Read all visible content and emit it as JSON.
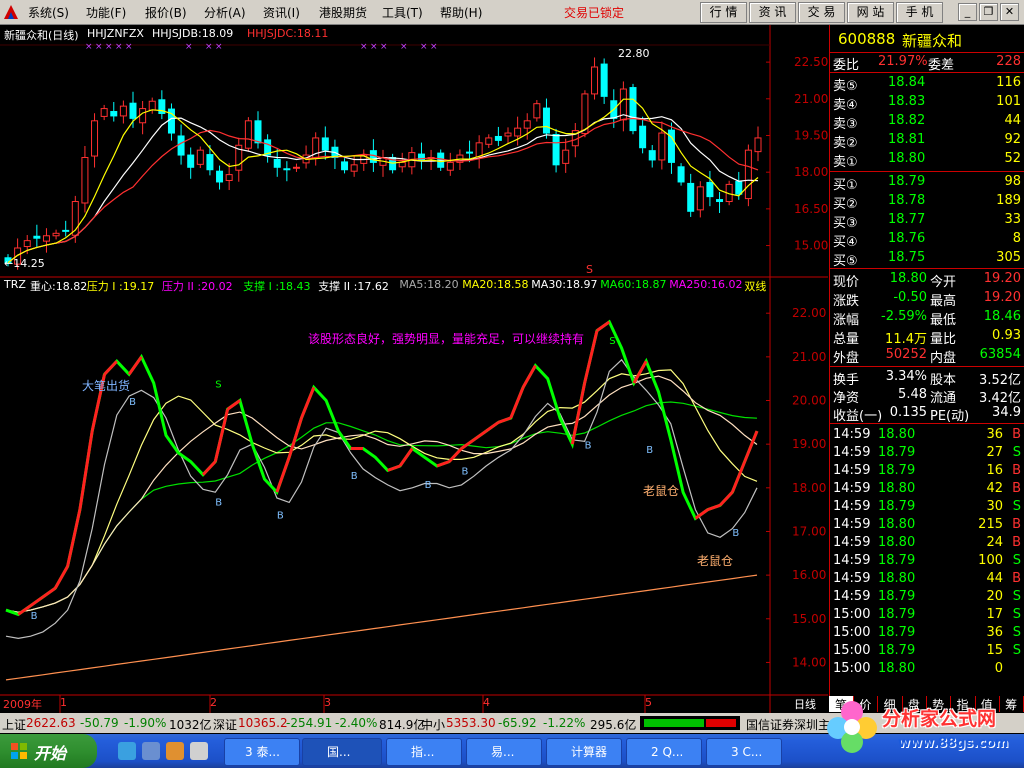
{
  "menu": {
    "items": [
      "系统(S)",
      "功能(F)",
      "报价(B)",
      "分析(A)",
      "资讯(I)",
      "港股期货",
      "工具(T)",
      "帮助(H)"
    ],
    "lock_status": "交易已锁定",
    "quick_buttons": [
      "行 情",
      "资 讯",
      "交 易",
      "网 站",
      "手 机"
    ]
  },
  "kline_header": {
    "title": "新疆众和(日线)",
    "indicator": "HHJZNFZX",
    "jdb_label": "HHJSJDB:18.09",
    "jdc_label": "HHJSJDC:18.11",
    "high_marker": "22.80",
    "low_marker": "←14.25",
    "s_marker": "S"
  },
  "trz_header": {
    "name": "TRZ",
    "items": [
      {
        "text": "重心:18.82",
        "color": "#ffffff"
      },
      {
        "text": "压力 I :19.17",
        "color": "#ffff00"
      },
      {
        "text": "压力 II :20.02",
        "color": "#ff00ff"
      },
      {
        "text": "支撑 I :18.43",
        "color": "#00ff00"
      },
      {
        "text": "支撑 II :17.62",
        "color": "#ffffff"
      },
      {
        "text": "MA5:18.20",
        "color": "#aaaaaa"
      },
      {
        "text": "MA20:18.58",
        "color": "#ffff00"
      },
      {
        "text": "MA30:18.97",
        "color": "#ffffff"
      },
      {
        "text": "MA60:18.87",
        "color": "#00ff00"
      },
      {
        "text": "MA250:16.02",
        "color": "#ff00ff"
      },
      {
        "text": "双线",
        "color": "#ffff00"
      }
    ],
    "comment": "该股形态良好，强势明显，量能充足，可以继续持有",
    "annotations": {
      "top_exit": "大笔出货",
      "laoshu1": "老鼠仓",
      "laoshu2": "老鼠仓"
    }
  },
  "time_axis": {
    "year_label": "2009年",
    "months": [
      "1",
      "2",
      "3",
      "4",
      "5"
    ],
    "period": "日线"
  },
  "chart_data": [
    {
      "type": "candlestick",
      "title": "新疆众和(日线)",
      "y_ticks": [
        22.5,
        21.0,
        19.5,
        18.0,
        16.5,
        15.0
      ],
      "ylim": [
        14.0,
        23.2
      ],
      "closes": [
        14.3,
        14.9,
        15.2,
        15.3,
        15.4,
        15.5,
        15.6,
        16.8,
        18.6,
        20.1,
        20.6,
        20.3,
        20.7,
        20.2,
        20.6,
        20.9,
        20.4,
        19.6,
        18.7,
        18.2,
        18.9,
        18.1,
        17.6,
        17.9,
        19.1,
        20.1,
        19.2,
        18.7,
        18.2,
        18.1,
        18.2,
        18.7,
        19.4,
        18.9,
        18.6,
        18.1,
        18.3,
        18.7,
        18.4,
        18.6,
        18.1,
        18.4,
        18.8,
        18.5,
        18.6,
        18.2,
        18.4,
        18.7,
        18.8,
        19.2,
        19.4,
        19.3,
        19.6,
        19.8,
        20.1,
        20.8,
        19.6,
        18.3,
        18.9,
        19.7,
        21.2,
        22.3,
        21.1,
        20.2,
        21.4,
        19.7,
        19.0,
        18.5,
        19.6,
        18.4,
        17.6,
        16.4,
        17.4,
        17.0,
        16.8,
        17.5,
        17.1,
        18.9,
        19.4
      ]
    },
    {
      "type": "line",
      "title": "TRZ",
      "y_ticks": [
        22.0,
        21.0,
        20.0,
        19.0,
        18.0,
        17.0,
        16.0,
        15.0,
        14.0
      ],
      "ylim": [
        13.3,
        22.6
      ],
      "series": [
        {
          "name": "重心",
          "values": [
            15.2,
            15.1,
            15.3,
            15.5,
            15.7,
            16.2,
            17.5,
            19.3,
            20.6,
            20.9,
            20.6,
            21.0,
            20.4,
            19.2,
            18.8,
            18.6,
            18.3,
            18.6,
            19.8,
            20.0,
            19.0,
            18.2,
            17.9,
            18.7,
            19.6,
            20.3,
            20.0,
            19.3,
            18.9,
            18.9,
            18.7,
            18.4,
            18.5,
            18.9,
            18.7,
            18.5,
            18.6,
            18.9,
            19.1,
            19.3,
            19.5,
            19.6,
            20.3,
            20.8,
            20.5,
            19.6,
            19.0,
            20.4,
            21.6,
            21.8,
            21.2,
            20.4,
            20.9,
            20.2,
            19.1,
            17.9,
            17.3,
            17.5,
            17.6,
            17.9,
            18.6,
            19.3
          ]
        }
      ]
    }
  ],
  "quote": {
    "code": "600888",
    "name": "新疆众和",
    "ratio_label": "委比",
    "ratio": "21.97%",
    "diff_label": "委差",
    "diff": "228",
    "asks": [
      {
        "label": "卖⑤",
        "price": "18.84",
        "vol": "116"
      },
      {
        "label": "卖④",
        "price": "18.83",
        "vol": "101"
      },
      {
        "label": "卖③",
        "price": "18.82",
        "vol": "44"
      },
      {
        "label": "卖②",
        "price": "18.81",
        "vol": "92"
      },
      {
        "label": "卖①",
        "price": "18.80",
        "vol": "52"
      }
    ],
    "bids": [
      {
        "label": "买①",
        "price": "18.79",
        "vol": "98"
      },
      {
        "label": "买②",
        "price": "18.78",
        "vol": "189"
      },
      {
        "label": "买③",
        "price": "18.77",
        "vol": "33"
      },
      {
        "label": "买④",
        "price": "18.76",
        "vol": "8"
      },
      {
        "label": "买⑤",
        "price": "18.75",
        "vol": "305"
      }
    ],
    "stats1": [
      {
        "l1": "现价",
        "v1": "18.80",
        "c1": "#00ff00",
        "l2": "今开",
        "v2": "19.20",
        "c2": "#ff3030"
      },
      {
        "l1": "涨跌",
        "v1": "-0.50",
        "c1": "#00ff00",
        "l2": "最高",
        "v2": "19.20",
        "c2": "#ff3030"
      },
      {
        "l1": "涨幅",
        "v1": "-2.59%",
        "c1": "#00ff00",
        "l2": "最低",
        "v2": "18.46",
        "c2": "#00ff00"
      },
      {
        "l1": "总量",
        "v1": "11.4万",
        "c1": "#ffff00",
        "l2": "量比",
        "v2": "0.93",
        "c2": "#ffff00"
      },
      {
        "l1": "外盘",
        "v1": "50252",
        "c1": "#ff3030",
        "l2": "内盘",
        "v2": "63854",
        "c2": "#00ff00"
      }
    ],
    "stats2": [
      {
        "l1": "换手",
        "v1": "3.34%",
        "l2": "股本",
        "v2": "3.52亿"
      },
      {
        "l1": "净资",
        "v1": "5.48",
        "l2": "流通",
        "v2": "3.42亿"
      },
      {
        "l1": "收益(一)",
        "v1": "0.135",
        "l2": "PE(动)",
        "v2": "34.9"
      }
    ],
    "ticks": [
      {
        "t": "14:59",
        "p": "18.80",
        "v": "36",
        "d": "B"
      },
      {
        "t": "14:59",
        "p": "18.79",
        "v": "27",
        "d": "S"
      },
      {
        "t": "14:59",
        "p": "18.79",
        "v": "16",
        "d": "B"
      },
      {
        "t": "14:59",
        "p": "18.80",
        "v": "42",
        "d": "B"
      },
      {
        "t": "14:59",
        "p": "18.79",
        "v": "30",
        "d": "S"
      },
      {
        "t": "14:59",
        "p": "18.80",
        "v": "215",
        "d": "B"
      },
      {
        "t": "14:59",
        "p": "18.80",
        "v": "24",
        "d": "B"
      },
      {
        "t": "14:59",
        "p": "18.79",
        "v": "100",
        "d": "S"
      },
      {
        "t": "14:59",
        "p": "18.80",
        "v": "44",
        "d": "B"
      },
      {
        "t": "14:59",
        "p": "18.79",
        "v": "20",
        "d": "S"
      },
      {
        "t": "15:00",
        "p": "18.79",
        "v": "17",
        "d": "S"
      },
      {
        "t": "15:00",
        "p": "18.79",
        "v": "36",
        "d": "S"
      },
      {
        "t": "15:00",
        "p": "18.79",
        "v": "15",
        "d": "S"
      },
      {
        "t": "15:00",
        "p": "18.80",
        "v": "0",
        "d": ""
      }
    ],
    "tabs": [
      "笔",
      "价",
      "细",
      "盘",
      "势",
      "指",
      "值",
      "筹"
    ]
  },
  "index_bar": {
    "sh_label": "上证",
    "sh_val": "2622.63",
    "sh_chg": "-50.79",
    "sh_pct": "-1.90%",
    "sh_amt": "1032亿",
    "sz_label": "深证",
    "sz_val": "10365.2",
    "sz_chg": "-254.91",
    "sz_pct": "-2.40%",
    "sz_amt": "814.9亿",
    "zx_label": "中小",
    "zx_val": "5353.30",
    "zx_chg": "-65.92",
    "zx_pct": "-1.22%",
    "zx_amt": "295.6亿",
    "broker": "国信证券深圳主"
  },
  "taskbar": {
    "start": "开始",
    "tasks": [
      "3 泰...",
      "国...",
      "指...",
      "易...",
      "计算器",
      "2 Q...",
      "3 C..."
    ]
  },
  "watermark": {
    "brand": "分析家公式网",
    "url": "www.88gs.com"
  }
}
